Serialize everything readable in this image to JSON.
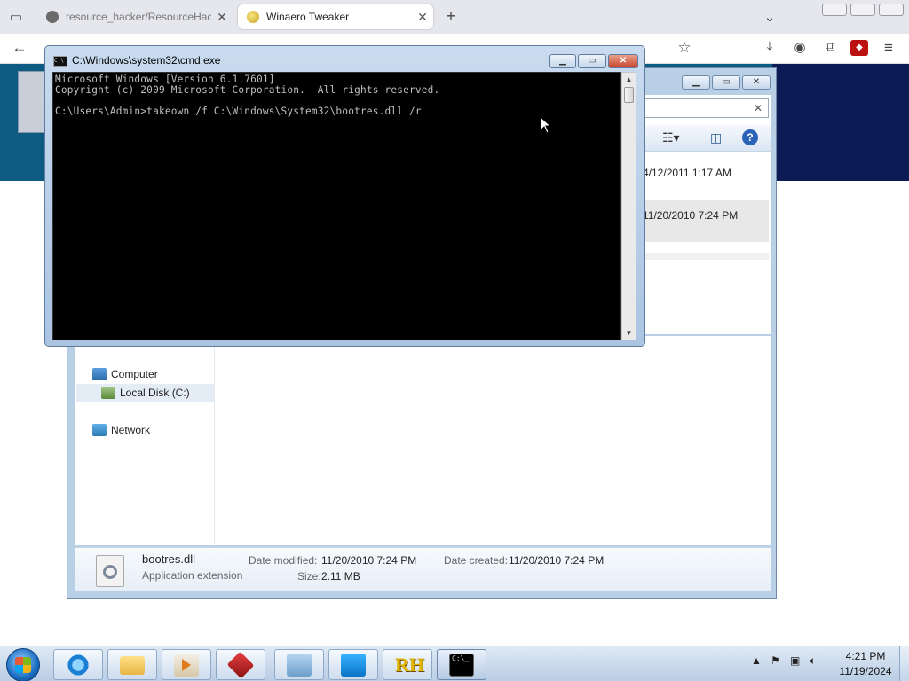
{
  "browser": {
    "tabs": [
      {
        "title": "resource_hacker/ResourceHack",
        "active": false
      },
      {
        "title": "Winaero Tweaker",
        "active": true
      }
    ],
    "new_tab_glyph": "+",
    "close_glyph": "✕",
    "icons": [
      "tab-list-icon",
      "back-icon",
      "bookmark-star-icon",
      "download-icon",
      "account-icon",
      "extensions-icon",
      "ublock-icon",
      "menu-icon"
    ]
  },
  "explorer": {
    "search_clear": "✕",
    "dates": [
      "4/12/2011 1:17 AM",
      "11/20/2010 7:24 PM"
    ],
    "nav": [
      {
        "label": "Computer"
      },
      {
        "label": "Local Disk (C:)"
      },
      {
        "label": "Network"
      }
    ],
    "details": {
      "file_name": "bootres.dll",
      "file_type": "Application extension",
      "date_modified_label": "Date modified:",
      "date_modified": "11/20/2010 7:24 PM",
      "date_created_label": "Date created:",
      "date_created": "11/20/2010 7:24 PM",
      "size_label": "Size:",
      "size": "2.11 MB"
    }
  },
  "cmd": {
    "title": "C:\\Windows\\system32\\cmd.exe",
    "icon_text": "C:\\",
    "lines": [
      "Microsoft Windows [Version 6.1.7601]",
      "Copyright (c) 2009 Microsoft Corporation.  All rights reserved.",
      "",
      "C:\\Users\\Admin>takeown /f C:\\Windows\\System32\\bootres.dll /r"
    ]
  },
  "taskbar": {
    "rh_label": "RH",
    "cmd_label": "C:\\_",
    "clock": {
      "time": "4:21 PM",
      "date": "11/19/2024"
    }
  },
  "colors": {
    "page_band": "#0d5a82",
    "cmd_background": "#000000",
    "cmd_text": "#c0c0c0",
    "taskbar": "#c8d8ec"
  }
}
